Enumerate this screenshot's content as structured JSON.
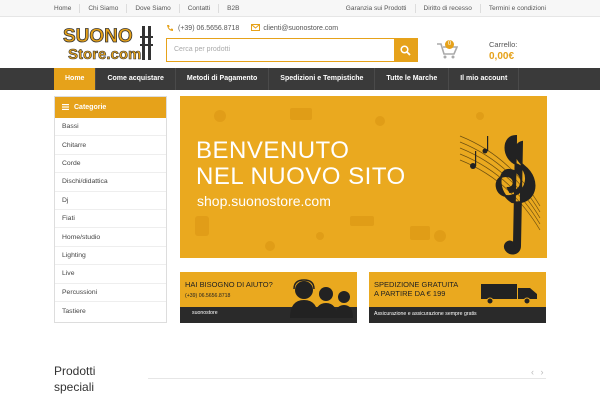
{
  "topbar": {
    "left": [
      "Home",
      "Chi Siamo",
      "Dove Siamo",
      "Contatti",
      "B2B"
    ],
    "right": [
      "Garanzia sui Prodotti",
      "Diritto di recesso",
      "Termini e condizioni"
    ]
  },
  "logo": {
    "line1": "SUONO",
    "line2": "Store.com"
  },
  "contact": {
    "phone": "(+39) 06.5656.8718",
    "email": "clienti@suonostore.com"
  },
  "search": {
    "placeholder": "Cerca per prodotti"
  },
  "cart": {
    "label": "Carrello:",
    "amount": "0,00€",
    "count": "0"
  },
  "nav": [
    "Home",
    "Come acquistare",
    "Metodi di Pagamento",
    "Spedizioni e Tempistiche",
    "Tutte le Marche",
    "Il mio account"
  ],
  "sidebar": {
    "title": "Categorie",
    "items": [
      "Bassi",
      "Chitarre",
      "Corde",
      "Dischi/didattica",
      "Dj",
      "Fiati",
      "Home/studio",
      "Lighting",
      "Live",
      "Percussioni",
      "Tastiere"
    ]
  },
  "banner": {
    "line1": "BENVENUTO",
    "line2": "NEL NUOVO SITO",
    "url": "shop.suonostore.com"
  },
  "promo1": {
    "line1": "HAI BISOGNO DI AIUTO?",
    "phone": "(+39) 06.5656.8718",
    "skype": "suonostore"
  },
  "promo2": {
    "line1": "SPEDIZIONE GRATUITA",
    "line2": "A PARTIRE DA € 199",
    "note": "Assicurazione e assicurazione sempre gratis"
  },
  "products": {
    "line1": "Prodotti",
    "line2": "speciali"
  },
  "colors": {
    "accent": "#e6a21a",
    "nav": "#3a3a3a"
  }
}
